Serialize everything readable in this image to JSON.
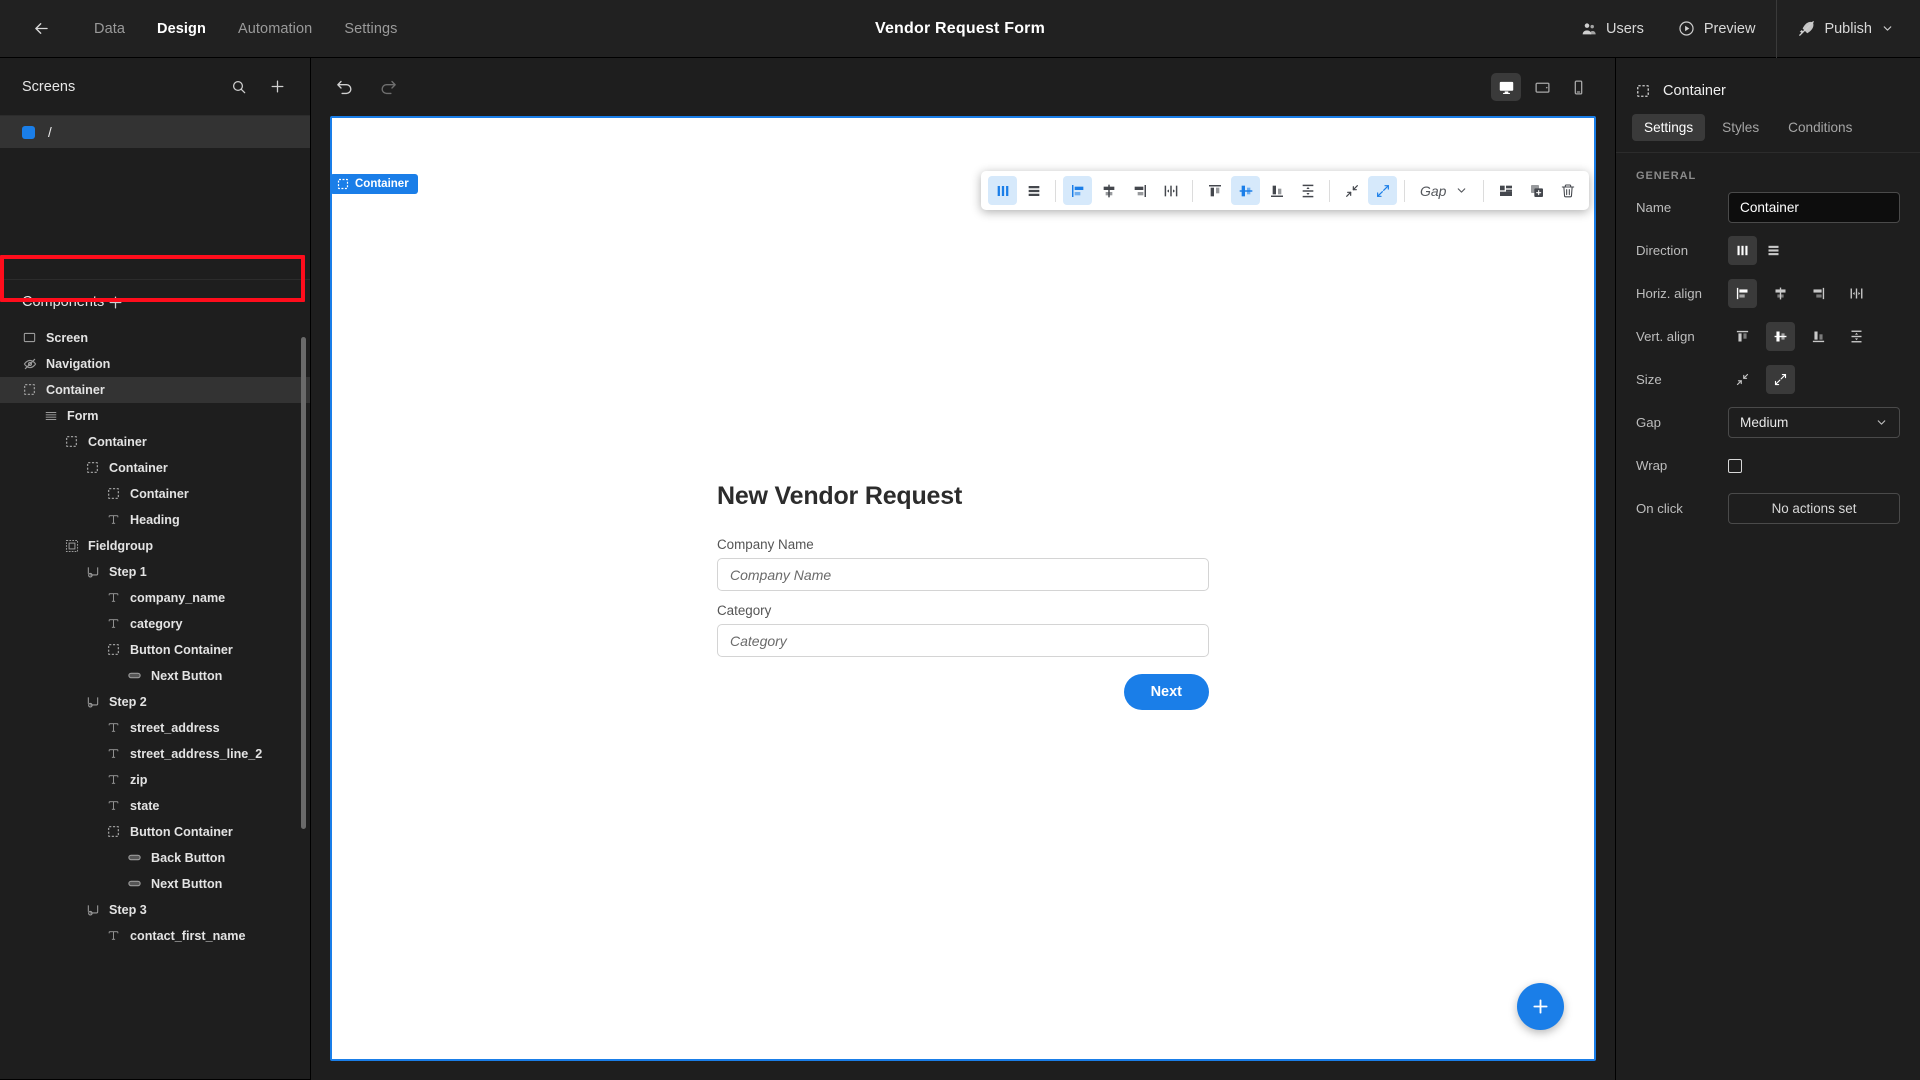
{
  "topbar": {
    "back_icon": "arrow-left-icon",
    "tabs": [
      {
        "label": "Data",
        "active": false
      },
      {
        "label": "Design",
        "active": true
      },
      {
        "label": "Automation",
        "active": false
      },
      {
        "label": "Settings",
        "active": false
      }
    ],
    "title": "Vendor Request Form",
    "users_label": "Users",
    "preview_label": "Preview",
    "publish_label": "Publish"
  },
  "screens_panel": {
    "title": "Screens",
    "search_icon": "search-icon",
    "add_icon": "plus-icon",
    "items": [
      {
        "label": "/",
        "selected": true,
        "color": "#1a7ee8"
      }
    ]
  },
  "components_panel": {
    "title": "Components",
    "add_icon": "plus-icon",
    "tree": [
      {
        "label": "Screen",
        "depth": 0,
        "icon": "screen-icon",
        "selected": false
      },
      {
        "label": "Navigation",
        "depth": 0,
        "icon": "eye-off-icon",
        "selected": false
      },
      {
        "label": "Container",
        "depth": 0,
        "icon": "container-icon",
        "selected": true
      },
      {
        "label": "Form",
        "depth": 1,
        "icon": "form-icon",
        "selected": false
      },
      {
        "label": "Container",
        "depth": 2,
        "icon": "container-icon",
        "selected": false
      },
      {
        "label": "Container",
        "depth": 3,
        "icon": "container-icon",
        "selected": false
      },
      {
        "label": "Container",
        "depth": 4,
        "icon": "container-icon",
        "selected": false
      },
      {
        "label": "Heading",
        "depth": 4,
        "icon": "text-icon",
        "selected": false
      },
      {
        "label": "Fieldgroup",
        "depth": 2,
        "icon": "fieldgroup-icon",
        "selected": false
      },
      {
        "label": "Step 1",
        "depth": 3,
        "icon": "step-icon",
        "selected": false
      },
      {
        "label": "company_name",
        "depth": 4,
        "icon": "text-icon",
        "selected": false
      },
      {
        "label": "category",
        "depth": 4,
        "icon": "text-icon",
        "selected": false
      },
      {
        "label": "Button Container",
        "depth": 4,
        "icon": "container-icon",
        "selected": false
      },
      {
        "label": "Next Button",
        "depth": 5,
        "icon": "button-icon",
        "selected": false
      },
      {
        "label": "Step 2",
        "depth": 3,
        "icon": "step-icon",
        "selected": false
      },
      {
        "label": "street_address",
        "depth": 4,
        "icon": "text-icon",
        "selected": false
      },
      {
        "label": "street_address_line_2",
        "depth": 4,
        "icon": "text-icon",
        "selected": false
      },
      {
        "label": "zip",
        "depth": 4,
        "icon": "text-icon",
        "selected": false
      },
      {
        "label": "state",
        "depth": 4,
        "icon": "text-icon",
        "selected": false
      },
      {
        "label": "Button Container",
        "depth": 4,
        "icon": "container-icon",
        "selected": false
      },
      {
        "label": "Back Button",
        "depth": 5,
        "icon": "button-icon",
        "selected": false
      },
      {
        "label": "Next Button",
        "depth": 5,
        "icon": "button-icon",
        "selected": false
      },
      {
        "label": "Step 3",
        "depth": 3,
        "icon": "step-icon",
        "selected": false
      },
      {
        "label": "contact_first_name",
        "depth": 4,
        "icon": "text-icon",
        "selected": false
      }
    ]
  },
  "canvas_bar": {
    "undo_icon": "undo-icon",
    "redo_icon": "redo-icon",
    "devices": [
      {
        "name": "desktop-icon",
        "active": true
      },
      {
        "name": "tablet-icon",
        "active": false
      },
      {
        "name": "mobile-icon",
        "active": false
      }
    ]
  },
  "selection_badge": {
    "label": "Container",
    "icon": "container-icon"
  },
  "floating_toolbar": {
    "groups": [
      [
        {
          "name": "direction-column-icon",
          "on": true
        },
        {
          "name": "direction-row-icon",
          "on": false
        }
      ],
      [
        {
          "name": "align-left-icon",
          "on": true
        },
        {
          "name": "align-center-icon",
          "on": false
        },
        {
          "name": "align-right-icon",
          "on": false
        },
        {
          "name": "align-space-between-icon",
          "on": false
        }
      ],
      [
        {
          "name": "align-top-icon",
          "on": false
        },
        {
          "name": "align-middle-icon",
          "on": true
        },
        {
          "name": "align-bottom-icon",
          "on": false
        },
        {
          "name": "align-stretch-vertical-icon",
          "on": false
        }
      ],
      [
        {
          "name": "size-shrink-icon",
          "on": false
        },
        {
          "name": "size-grow-icon",
          "on": true
        }
      ]
    ],
    "gap_label": "Gap",
    "gap_chevron_icon": "chevron-down-icon",
    "right_actions": [
      {
        "name": "layout-icon"
      },
      {
        "name": "duplicate-icon"
      },
      {
        "name": "trash-icon"
      }
    ]
  },
  "form": {
    "title": "New Vendor Request",
    "fields": [
      {
        "label": "Company Name",
        "placeholder": "Company Name"
      },
      {
        "label": "Category",
        "placeholder": "Category"
      }
    ],
    "next_button": "Next",
    "fab_icon": "plus-icon"
  },
  "inspector": {
    "title": "Container",
    "title_icon": "container-icon",
    "tabs": [
      {
        "label": "Settings",
        "active": true
      },
      {
        "label": "Styles",
        "active": false
      },
      {
        "label": "Conditions",
        "active": false
      }
    ],
    "section": "GENERAL",
    "name_label": "Name",
    "name_value": "Container",
    "direction_label": "Direction",
    "direction_options": [
      {
        "name": "direction-column-icon",
        "on": true
      },
      {
        "name": "direction-row-icon",
        "on": false
      }
    ],
    "horiz_label": "Horiz. align",
    "horiz_options": [
      {
        "name": "align-left-icon",
        "on": true
      },
      {
        "name": "align-center-icon",
        "on": false
      },
      {
        "name": "align-right-icon",
        "on": false
      },
      {
        "name": "align-space-between-icon",
        "on": false
      }
    ],
    "vert_label": "Vert. align",
    "vert_options": [
      {
        "name": "align-top-icon",
        "on": false
      },
      {
        "name": "align-middle-icon",
        "on": true
      },
      {
        "name": "align-bottom-icon",
        "on": false
      },
      {
        "name": "align-stretch-vertical-icon",
        "on": false
      }
    ],
    "size_label": "Size",
    "size_options": [
      {
        "name": "size-shrink-icon",
        "on": false
      },
      {
        "name": "size-grow-icon",
        "on": true
      }
    ],
    "gap_label": "Gap",
    "gap_value": "Medium",
    "wrap_label": "Wrap",
    "wrap_checked": false,
    "onclick_label": "On click",
    "onclick_value": "No actions set"
  },
  "highlight": {
    "color": "#ff0d1c",
    "target": "vert-align-row"
  }
}
